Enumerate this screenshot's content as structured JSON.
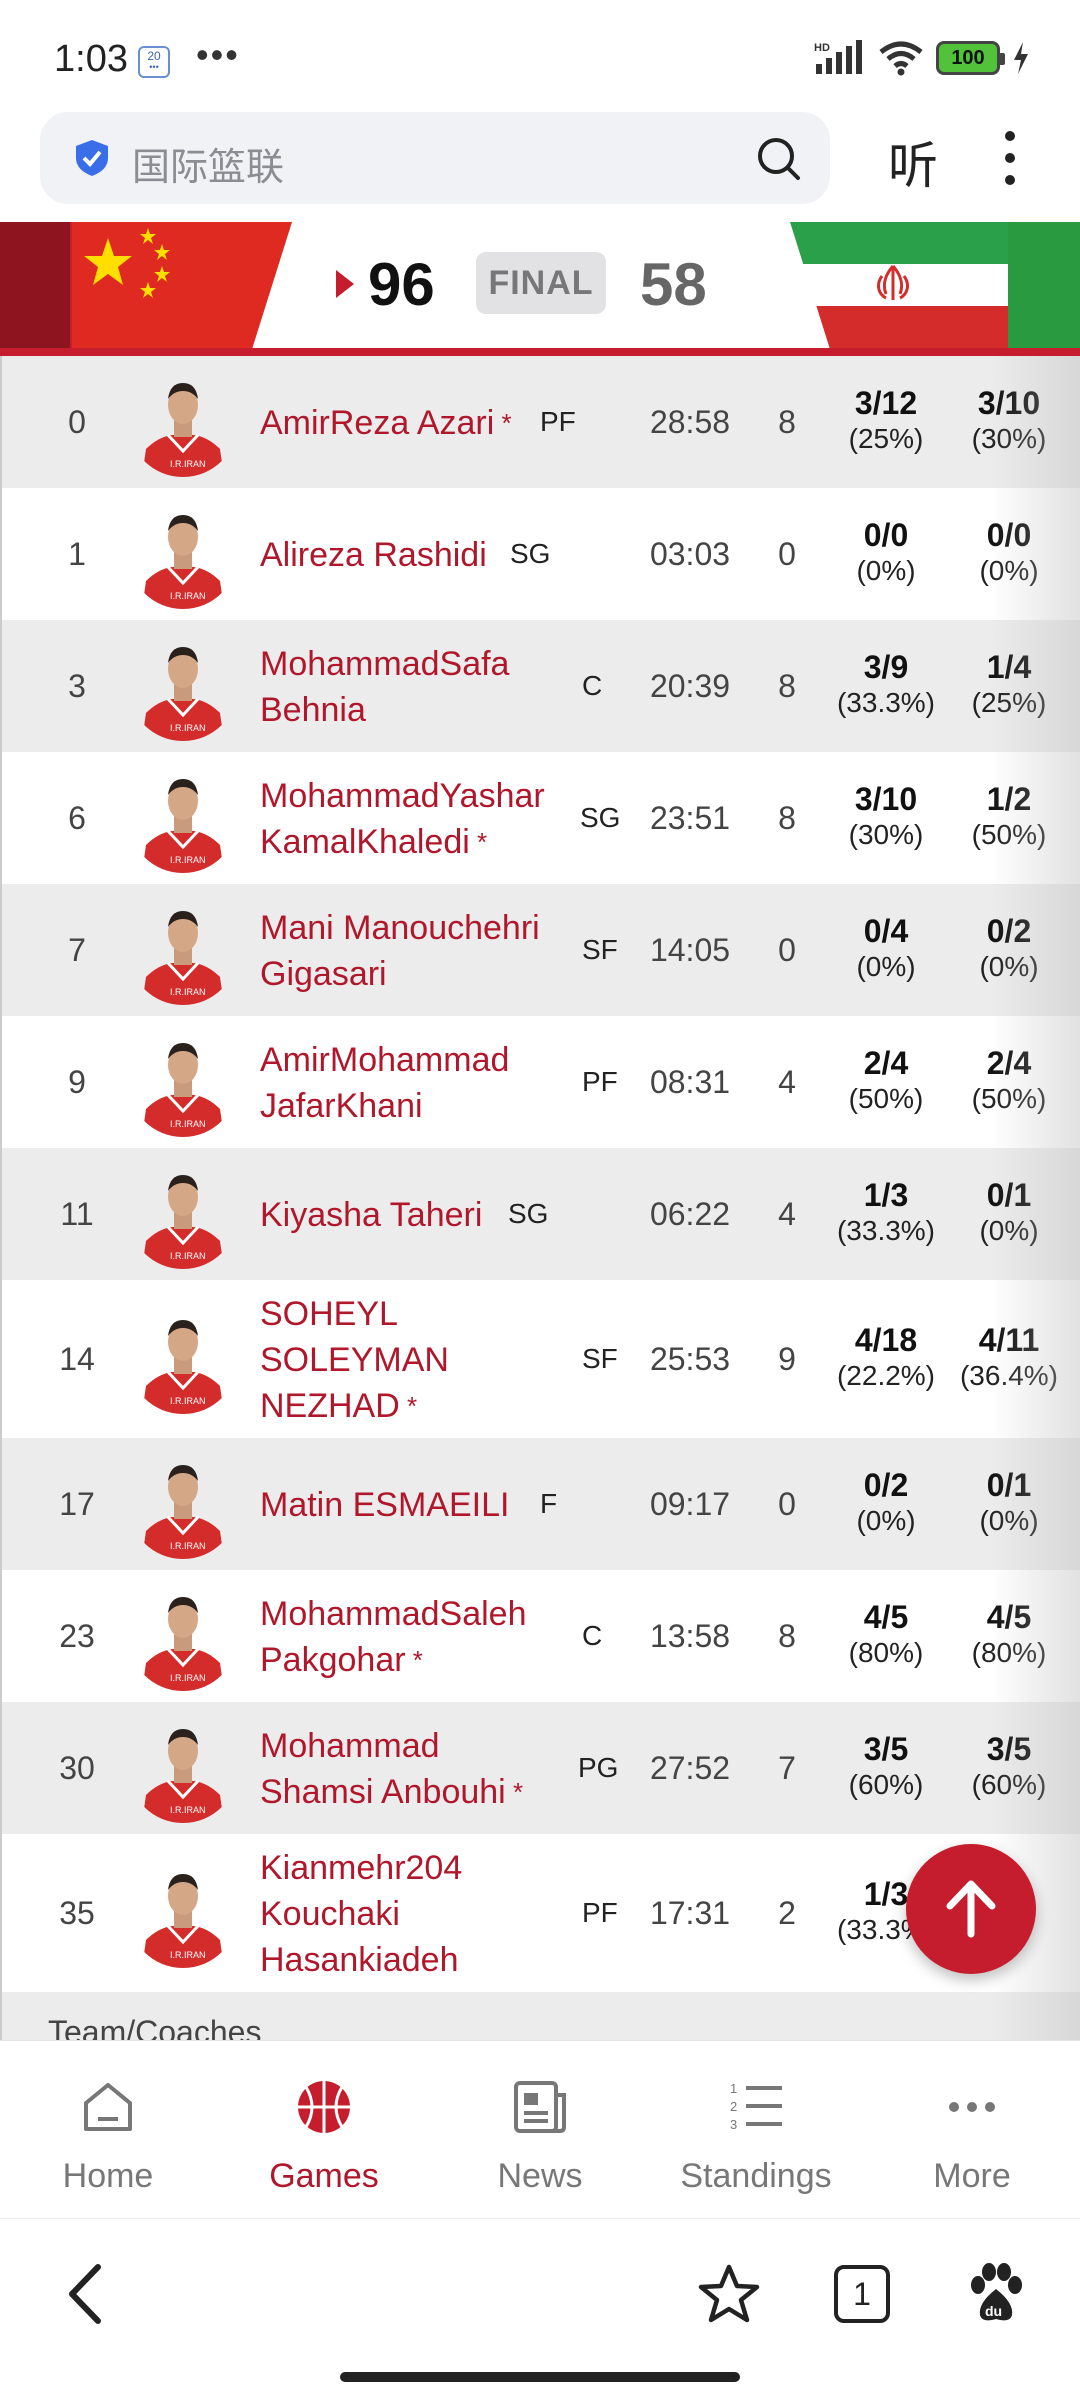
{
  "status_bar": {
    "time": "1:03",
    "badge_top": "20",
    "badge_bottom": "•••",
    "dots": "•••",
    "battery": "100",
    "network": "HD"
  },
  "search": {
    "text": "国际篮联",
    "listen_label": "听"
  },
  "scoreboard": {
    "home_score": "96",
    "status": "FINAL",
    "away_score": "58",
    "colors": {
      "accent": "#c61d2e"
    }
  },
  "players": [
    {
      "num": "0",
      "name": "AmirReza Azari",
      "star": true,
      "pos": "PF",
      "min": "28:58",
      "pts": "8",
      "fg": "3/12",
      "fg_pct": "(25%)",
      "tp": "3/10",
      "tp_pct": "(30%)"
    },
    {
      "num": "1",
      "name": "Alireza Rashidi",
      "star": false,
      "pos": "SG",
      "min": "03:03",
      "pts": "0",
      "fg": "0/0",
      "fg_pct": "(0%)",
      "tp": "0/0",
      "tp_pct": "(0%)"
    },
    {
      "num": "3",
      "name": "MohammadSafa Behnia",
      "star": false,
      "pos": "C",
      "min": "20:39",
      "pts": "8",
      "fg": "3/9",
      "fg_pct": "(33.3%)",
      "tp": "1/4",
      "tp_pct": "(25%)"
    },
    {
      "num": "6",
      "name": "MohammadYashar KamalKhaledi",
      "star": true,
      "pos": "SG",
      "min": "23:51",
      "pts": "8",
      "fg": "3/10",
      "fg_pct": "(30%)",
      "tp": "1/2",
      "tp_pct": "(50%)"
    },
    {
      "num": "7",
      "name": "Mani Manouchehri Gigasari",
      "star": false,
      "pos": "SF",
      "min": "14:05",
      "pts": "0",
      "fg": "0/4",
      "fg_pct": "(0%)",
      "tp": "0/2",
      "tp_pct": "(0%)"
    },
    {
      "num": "9",
      "name": "AmirMohammad JafarKhani",
      "star": false,
      "pos": "PF",
      "min": "08:31",
      "pts": "4",
      "fg": "2/4",
      "fg_pct": "(50%)",
      "tp": "2/4",
      "tp_pct": "(50%)"
    },
    {
      "num": "11",
      "name": "Kiyasha Taheri",
      "star": false,
      "pos": "SG",
      "min": "06:22",
      "pts": "4",
      "fg": "1/3",
      "fg_pct": "(33.3%)",
      "tp": "0/1",
      "tp_pct": "(0%)"
    },
    {
      "num": "14",
      "name": "SOHEYL SOLEYMAN NEZHAD",
      "star": true,
      "pos": "SF",
      "min": "25:53",
      "pts": "9",
      "fg": "4/18",
      "fg_pct": "(22.2%)",
      "tp": "4/11",
      "tp_pct": "(36.4%)"
    },
    {
      "num": "17",
      "name": "Matin ESMAEILI",
      "star": false,
      "pos": "F",
      "min": "09:17",
      "pts": "0",
      "fg": "0/2",
      "fg_pct": "(0%)",
      "tp": "0/1",
      "tp_pct": "(0%)"
    },
    {
      "num": "23",
      "name": "MohammadSaleh Pakgohar",
      "star": true,
      "pos": "C",
      "min": "13:58",
      "pts": "8",
      "fg": "4/5",
      "fg_pct": "(80%)",
      "tp": "4/5",
      "tp_pct": "(80%)"
    },
    {
      "num": "30",
      "name": "Mohammad Shamsi Anbouhi",
      "star": true,
      "pos": "PG",
      "min": "27:52",
      "pts": "7",
      "fg": "3/5",
      "fg_pct": "(60%)",
      "tp": "3/5",
      "tp_pct": "(60%)"
    },
    {
      "num": "35",
      "name": "Kianmehr204 Kouchaki Hasankiadeh",
      "star": false,
      "pos": "PF",
      "min": "17:31",
      "pts": "2",
      "fg": "1/3",
      "fg_pct": "(33.3%)",
      "tp": "",
      "tp_pct": "%)"
    }
  ],
  "section_label": "Team/Coaches",
  "nav": [
    {
      "label": "Home",
      "icon": "home-icon",
      "active": false
    },
    {
      "label": "Games",
      "icon": "basketball-icon",
      "active": true
    },
    {
      "label": "News",
      "icon": "news-icon",
      "active": false
    },
    {
      "label": "Standings",
      "icon": "standings-icon",
      "active": false
    },
    {
      "label": "More",
      "icon": "more-icon",
      "active": false
    }
  ],
  "browser": {
    "tab_count": "1"
  }
}
